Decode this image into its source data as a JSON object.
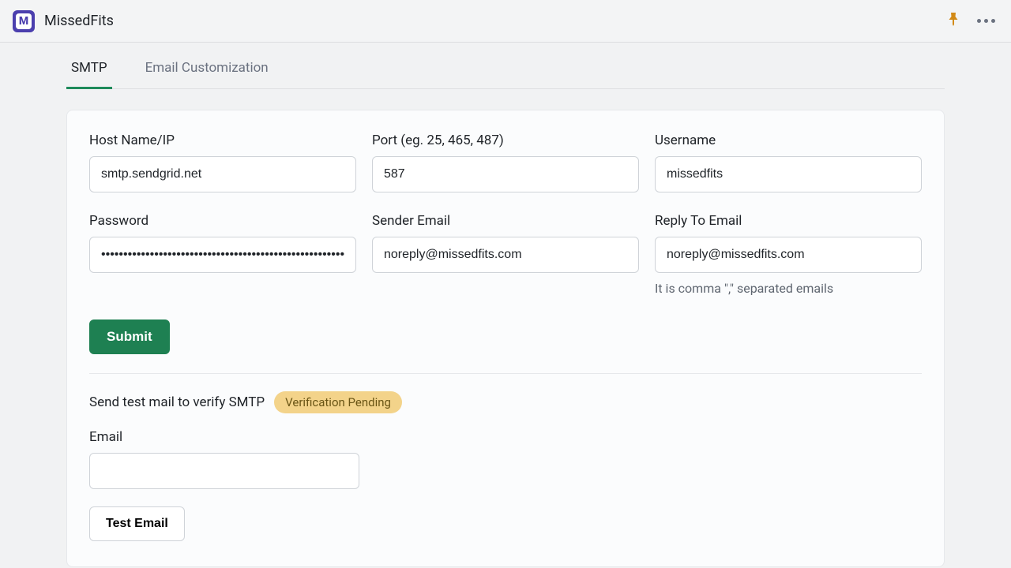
{
  "header": {
    "app_name": "MissedFits",
    "app_initial": "M"
  },
  "tabs": [
    {
      "label": "SMTP",
      "active": true
    },
    {
      "label": "Email Customization",
      "active": false
    }
  ],
  "form": {
    "host_label": "Host Name/IP",
    "host_value": "smtp.sendgrid.net",
    "port_label": "Port (eg. 25, 465, 487)",
    "port_value": "587",
    "username_label": "Username",
    "username_value": "missedfits",
    "password_label": "Password",
    "password_value": "••••••••••••••••••••••••••••••••••••••••••••••••••••••••",
    "sender_label": "Sender Email",
    "sender_value": "noreply@missedfits.com",
    "reply_label": "Reply To Email",
    "reply_value": "noreply@missedfits.com",
    "reply_hint": "It is comma \",\" separated emails",
    "submit_label": "Submit"
  },
  "test": {
    "title": "Send test mail to verify SMTP",
    "badge": "Verification Pending",
    "email_label": "Email",
    "email_value": "",
    "button_label": "Test Email"
  }
}
